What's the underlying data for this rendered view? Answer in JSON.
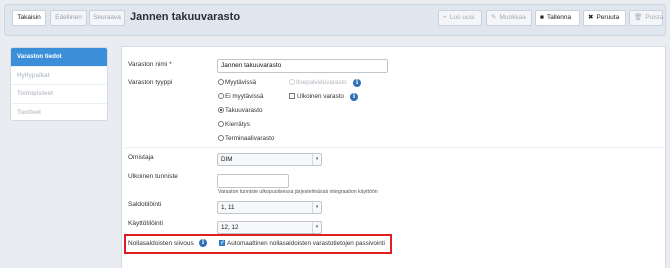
{
  "toolbar": {
    "back_label": "Takaisin",
    "prev_label": "Edellinen",
    "next_label": "Seuraava",
    "title": "Jannen takuuvarasto",
    "new_label": "Luo uusi",
    "edit_label": "Muokkaa",
    "save_label": "Tallenna",
    "cancel_label": "Peruuta",
    "delete_label": "Poista"
  },
  "sidebar": {
    "items": [
      {
        "label": "Varaston tiedot",
        "active": true
      },
      {
        "label": "Hyllypaikat",
        "active": false
      },
      {
        "label": "Toimipisteet",
        "active": false
      },
      {
        "label": "Tuotteet",
        "active": false
      }
    ]
  },
  "form": {
    "name_label": "Varaston nimi",
    "name_required": "*",
    "name_value": "Jannen takuuvarasto",
    "type_label": "Varaston tyyppi",
    "type_options": {
      "myytavissa": "Myytävissä",
      "itsepalvelu": "Itsepalveluvarasto",
      "ei_myytavissa": "Ei myytävissä",
      "ulkoinen": "Ulkoinen varasto",
      "takuuvarasto": "Takuuvarasto",
      "kierratys": "Kierrätys",
      "terminaali": "Terminaalivarasto"
    },
    "owner_label": "Omistaja",
    "owner_value": "DIM",
    "external_id_label": "Ulkoinen tunniste",
    "external_id_value": "",
    "external_id_hint": "Varaston tunniste ulkopuolisessa järjestelmässä integraation käyttöön",
    "balance_sort_label": "Saldotilöinti",
    "balance_sort_value": "1, 11",
    "usage_sort_label": "Käyttötilöinti",
    "usage_sort_value": "12, 12",
    "zero_balance_label": "Nollasaldoisten siivous",
    "zero_balance_checkbox_label": "Automaattinen nollasaldoisten varastotietojen passivointi",
    "zero_balance_checked": true
  },
  "colors": {
    "accent": "#3b8fd8",
    "highlight": "#e02020",
    "info": "#2f6fb5"
  }
}
